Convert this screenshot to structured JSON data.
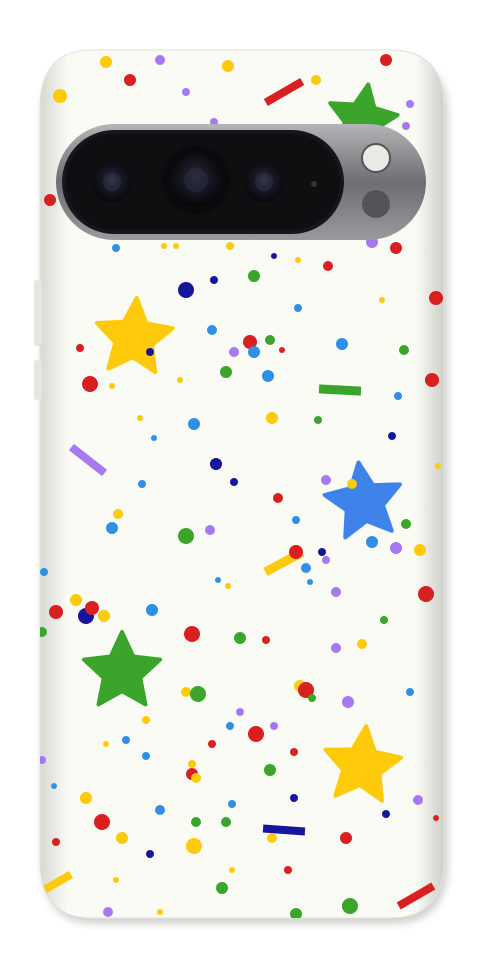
{
  "product": {
    "type": "phone-case",
    "pattern": "confetti",
    "case_color": "#fdfdf8",
    "camera_bar_color": "#1c1c1f",
    "camera_ring_color": "#8a8a8e"
  },
  "palette": {
    "red": "#d91f1f",
    "yellow": "#ffca0a",
    "green": "#3aa52a",
    "blue": "#2f8fe6",
    "navy": "#15159e",
    "purple": "#a679f0",
    "star_blue": "#3f83ea"
  },
  "icons": {
    "camera-lens": "camera-icon",
    "flash": "flash-icon",
    "star": "star-icon"
  }
}
